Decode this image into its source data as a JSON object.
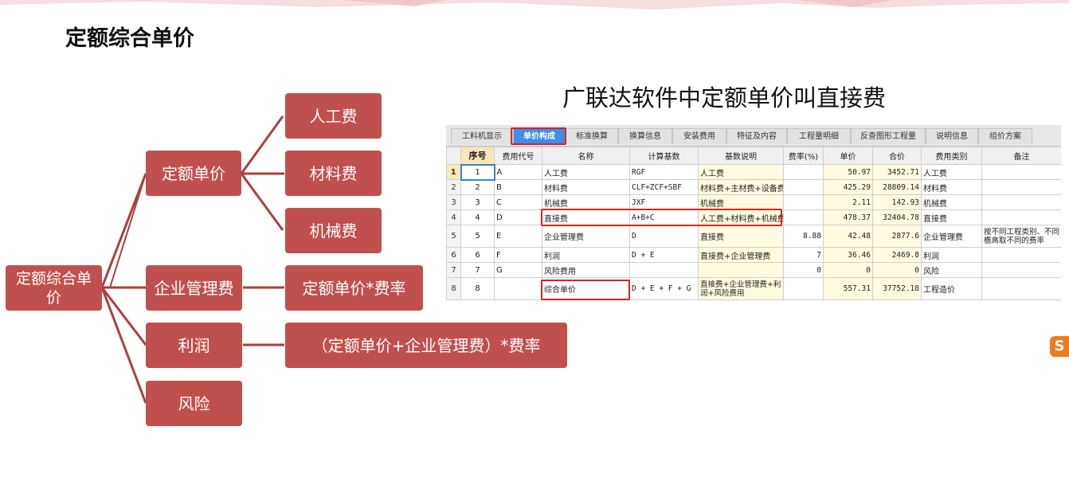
{
  "page": {
    "title": "定额综合单价"
  },
  "tree": {
    "root": "定额综合单价",
    "level1": [
      "定额单价",
      "企业管理费",
      "利润",
      "风险"
    ],
    "quota_children": [
      "人工费",
      "材料费",
      "机械费"
    ],
    "mgmt_formula": "定额单价*费率",
    "profit_formula": "（定额单价+企业管理费）*费率"
  },
  "software": {
    "caption": "广联达软件中定额单价叫直接费",
    "tabs": [
      "工料机显示",
      "单价构成",
      "标准换算",
      "换算信息",
      "安装费用",
      "特征及内容",
      "工程量明细",
      "反查图形工程量",
      "说明信息",
      "组价方案"
    ],
    "active_tab": "单价构成",
    "columns": [
      "",
      "序号",
      "费用代号",
      "名称",
      "计算基数",
      "基数说明",
      "费率(%)",
      "单价",
      "合价",
      "费用类别",
      "备注"
    ],
    "rows": [
      {
        "row": "1",
        "seq": "1",
        "code": "A",
        "name": "人工费",
        "base": "RGF",
        "desc": "人工费",
        "rate": "",
        "price": "50.97",
        "total": "3452.71",
        "type": "人工费",
        "note": ""
      },
      {
        "row": "2",
        "seq": "2",
        "code": "B",
        "name": "材料费",
        "base": "CLF+ZCF+SBF",
        "desc": "材料费+主材费+设备费",
        "rate": "",
        "price": "425.29",
        "total": "28809.14",
        "type": "材料费",
        "note": ""
      },
      {
        "row": "3",
        "seq": "3",
        "code": "C",
        "name": "机械费",
        "base": "JXF",
        "desc": "机械费",
        "rate": "",
        "price": "2.11",
        "total": "142.93",
        "type": "机械费",
        "note": ""
      },
      {
        "row": "4",
        "seq": "4",
        "code": "D",
        "name": "直接费",
        "base": "A+B+C",
        "desc": "人工费+材料费+机械费",
        "rate": "",
        "price": "478.37",
        "total": "32404.78",
        "type": "直接费",
        "note": ""
      },
      {
        "row": "5",
        "seq": "5",
        "code": "E",
        "name": "企业管理费",
        "base": "D",
        "desc": "直接费",
        "rate": "8.88",
        "price": "42.48",
        "total": "2877.6",
        "type": "企业管理费",
        "note": "按不同工程类别、不同檐高取不同的费率"
      },
      {
        "row": "6",
        "seq": "6",
        "code": "F",
        "name": "利润",
        "base": "D + E",
        "desc": "直接费+企业管理费",
        "rate": "7",
        "price": "36.46",
        "total": "2469.8",
        "type": "利润",
        "note": ""
      },
      {
        "row": "7",
        "seq": "7",
        "code": "G",
        "name": "风险费用",
        "base": "",
        "desc": "",
        "rate": "0",
        "price": "0",
        "total": "0",
        "type": "风险",
        "note": ""
      },
      {
        "row": "8",
        "seq": "8",
        "code": "",
        "name": "综合单价",
        "base": "D + E + F + G",
        "desc": "直接费+企业管理费+利润+风险费用",
        "rate": "",
        "price": "557.31",
        "total": "37752.18",
        "type": "工程造价",
        "note": ""
      }
    ]
  },
  "colors": {
    "box": "#c0504d",
    "tree_line": "#a9403d",
    "highlight": "#e02020",
    "active_tab": "#3c8ee8"
  },
  "icons": {
    "ime": "sogou-ime-icon"
  }
}
